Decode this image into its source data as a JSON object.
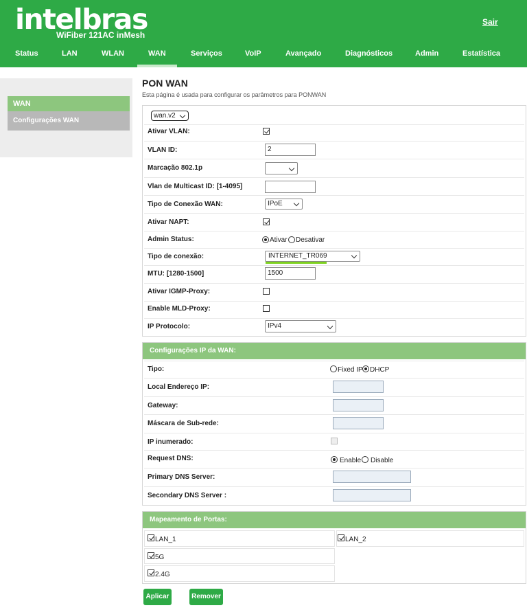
{
  "header": {
    "logo": "intelbras",
    "model": "WiFiber 121AC inMesh",
    "logout": "Sair",
    "nav": [
      "Status",
      "LAN",
      "WLAN",
      "WAN",
      "Serviços",
      "VoIP",
      "Avançado",
      "Diagnósticos",
      "Admin",
      "Estatística"
    ],
    "active_nav": "WAN"
  },
  "sidebar": {
    "heading": "WAN",
    "items": [
      "Configurações WAN"
    ]
  },
  "page": {
    "title": "PON WAN",
    "description": "Esta página é usada para configurar os parâmetros para PONWAN"
  },
  "wan": {
    "connection_select": "wan.v2",
    "labels": {
      "vlan": "Ativar VLAN:",
      "vlan_id": "VLAN ID:",
      "mark8021p": "Marcação 802.1p",
      "multicast": "Vlan de Multicast ID: [1-4095]",
      "conn_type": "Tipo de Conexão WAN:",
      "napt": "Ativar NAPT:",
      "admin": "Admin Status:",
      "conexao": "Tipo de conexão:",
      "mtu": "MTU: [1280-1500]",
      "igmp": "Ativar IGMP-Proxy:",
      "mld": "Enable MLD-Proxy:",
      "ipproto": "IP Protocolo:"
    },
    "values": {
      "vlan_enabled": true,
      "vlan_id": "2",
      "mark8021p": "",
      "multicast": "",
      "conn_type": "IPoE",
      "napt_enabled": true,
      "admin_on": "Ativar",
      "admin_off": "Desativar",
      "admin_status": "Ativar",
      "conexao": "INTERNET_TR069",
      "mtu": "1500",
      "igmp_enabled": false,
      "mld_enabled": false,
      "ipproto": "IPv4"
    }
  },
  "ip_config": {
    "heading": "Configurações IP da WAN:",
    "labels": {
      "tipo": "Tipo:",
      "local_ip": "Local Endereço IP:",
      "gateway": "Gateway:",
      "mask": "Máscara de Sub-rede:",
      "unnumbered": "IP inumerado:",
      "request_dns": "Request DNS:",
      "dns1": "Primary DNS Server:",
      "dns2": "Secondary DNS Server :"
    },
    "values": {
      "tipo_fixed": "Fixed IP",
      "tipo_dhcp": "DHCP",
      "tipo": "DHCP",
      "local_ip": "",
      "gateway": "",
      "mask": "",
      "unnumbered": false,
      "dns_enable": "Enable",
      "dns_disable": "Disable",
      "request_dns": "Enable",
      "dns1": "",
      "dns2": ""
    }
  },
  "port_map": {
    "heading": "Mapeamento de Portas:",
    "ports": [
      {
        "label": "LAN_1",
        "checked": true
      },
      {
        "label": "LAN_2",
        "checked": true
      },
      {
        "label": "5G",
        "checked": true
      },
      {
        "label": "2.4G",
        "checked": true
      }
    ]
  },
  "buttons": {
    "apply": "Aplicar",
    "remove": "Remover"
  }
}
